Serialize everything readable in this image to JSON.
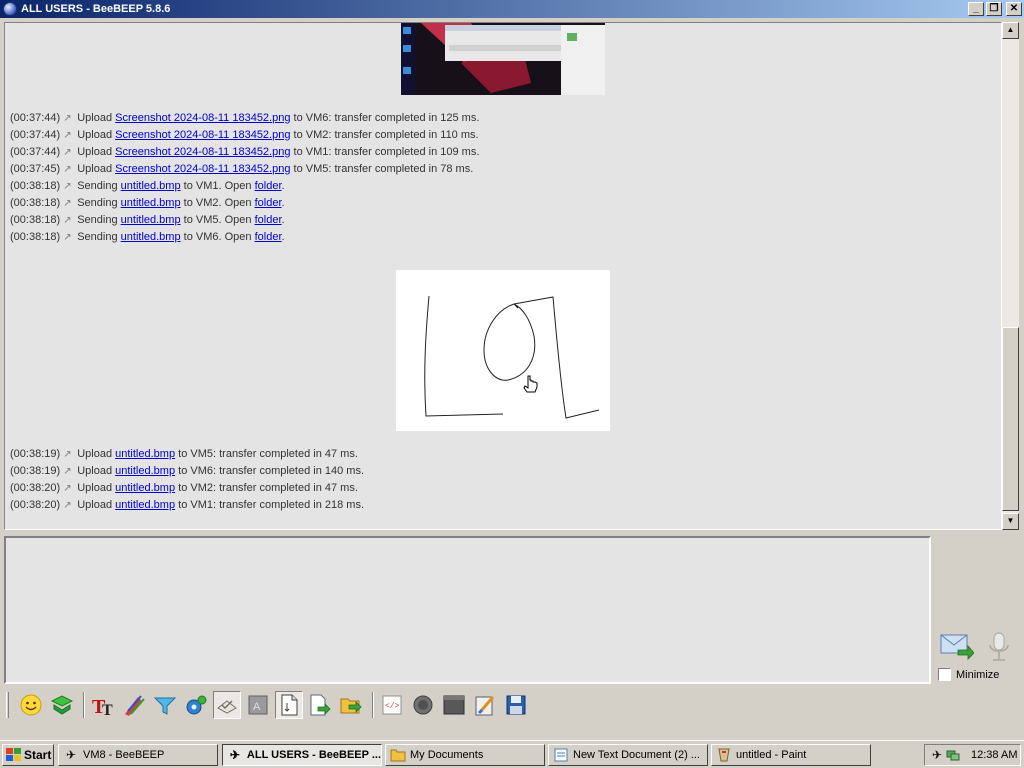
{
  "window": {
    "title": "ALL USERS - BeeBEEP 5.8.6"
  },
  "log_upload_1": [
    {
      "time": "(00:37:44)",
      "action": "Upload",
      "file": "Screenshot 2024-08-11 183452.png",
      "rest": "to VM6: transfer completed in 125 ms."
    },
    {
      "time": "(00:37:44)",
      "action": "Upload",
      "file": "Screenshot 2024-08-11 183452.png",
      "rest": "to VM2: transfer completed in 110 ms."
    },
    {
      "time": "(00:37:44)",
      "action": "Upload",
      "file": "Screenshot 2024-08-11 183452.png",
      "rest": "to VM1: transfer completed in 109 ms."
    },
    {
      "time": "(00:37:45)",
      "action": "Upload",
      "file": "Screenshot 2024-08-11 183452.png",
      "rest": "to VM5: transfer completed in 78 ms."
    }
  ],
  "log_sending": [
    {
      "time": "(00:38:18)",
      "action": "Sending",
      "file": "untitled.bmp",
      "mid": "to VM1. Open",
      "link2": "folder",
      "end": "."
    },
    {
      "time": "(00:38:18)",
      "action": "Sending",
      "file": "untitled.bmp",
      "mid": "to VM2. Open",
      "link2": "folder",
      "end": "."
    },
    {
      "time": "(00:38:18)",
      "action": "Sending",
      "file": "untitled.bmp",
      "mid": "to VM5. Open",
      "link2": "folder",
      "end": "."
    },
    {
      "time": "(00:38:18)",
      "action": "Sending",
      "file": "untitled.bmp",
      "mid": "to VM6. Open",
      "link2": "folder",
      "end": "."
    }
  ],
  "log_upload_2": [
    {
      "time": "(00:38:19)",
      "action": "Upload",
      "file": "untitled.bmp",
      "rest": "to VM5: transfer completed in 47 ms."
    },
    {
      "time": "(00:38:19)",
      "action": "Upload",
      "file": "untitled.bmp",
      "rest": "to VM6: transfer completed in 140 ms."
    },
    {
      "time": "(00:38:20)",
      "action": "Upload",
      "file": "untitled.bmp",
      "rest": "to VM2: transfer completed in 47 ms."
    },
    {
      "time": "(00:38:20)",
      "action": "Upload",
      "file": "untitled.bmp",
      "rest": "to VM1: transfer completed in 218 ms."
    }
  ],
  "input": {
    "minimize_label": "Minimize"
  },
  "toolbar": {
    "icons": [
      "emoticon-icon",
      "download-icon",
      "font-icon",
      "color-pen-icon",
      "filter-icon",
      "settings-icon",
      "spellcheck-icon",
      "font-size-icon",
      "file-icon",
      "send-file-icon",
      "folder-share-icon",
      "html-icon",
      "record-icon",
      "screenshot-icon",
      "clear-icon",
      "save-icon"
    ]
  },
  "taskbar": {
    "start_label": "Start",
    "tasks": [
      {
        "label": "VM8 - BeeBEEP",
        "icon": "beebeep-icon"
      },
      {
        "label": "ALL USERS - BeeBEEP ...",
        "icon": "beebeep-icon"
      },
      {
        "label": "My Documents",
        "icon": "folder-icon"
      },
      {
        "label": "New Text Document (2) ...",
        "icon": "notepad-icon"
      },
      {
        "label": "untitled - Paint",
        "icon": "paint-icon"
      }
    ],
    "clock": "12:38 AM"
  }
}
